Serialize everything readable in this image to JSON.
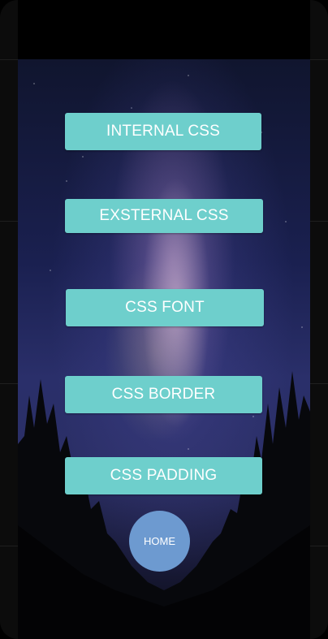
{
  "colors": {
    "button_bg": "#6ecfcc",
    "button_text": "#ffffff",
    "home_bg": "#6d9ad0",
    "frame": "#0b0b0b"
  },
  "buttons": {
    "internal_css": "INTERNAL CSS",
    "external_css": "EXSTERNAL CSS",
    "css_font": "CSS FONT",
    "css_border": "CSS BORDER",
    "css_padding": "CSS PADDING"
  },
  "home_button": {
    "label": "HOME"
  }
}
